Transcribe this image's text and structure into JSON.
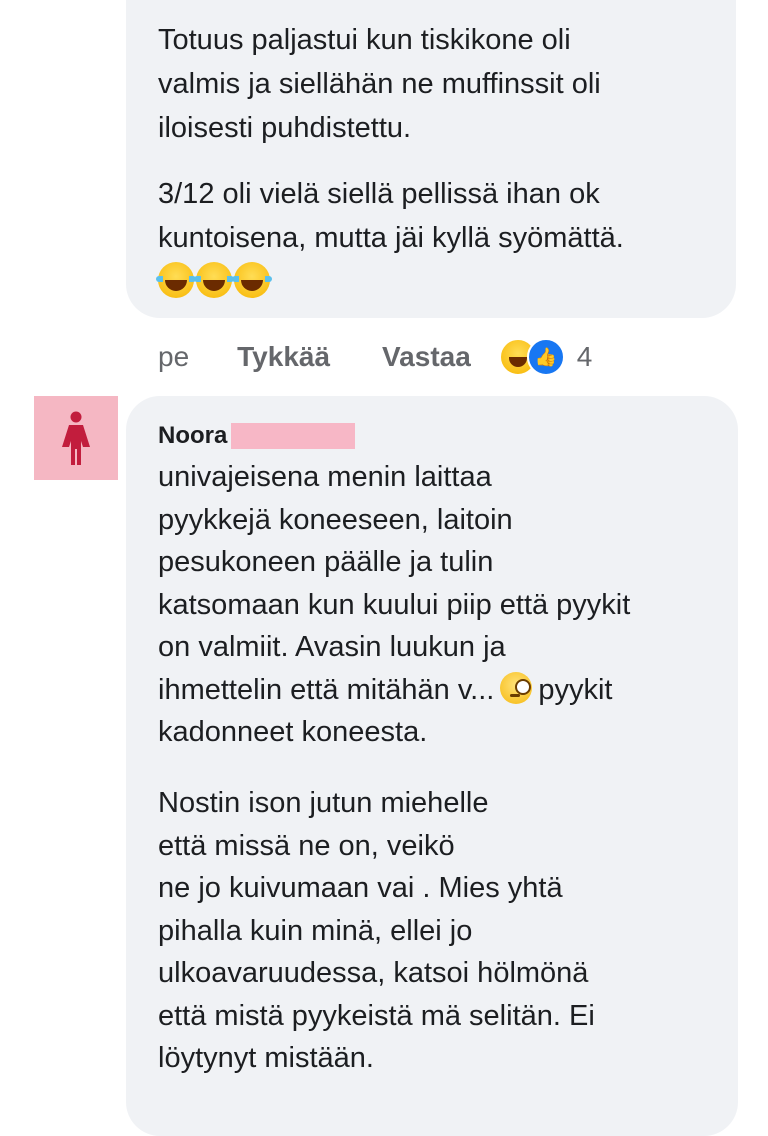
{
  "comment_top": {
    "paragraph_1": "Totuus paljastui kun tiskikone oli\nvalmis ja siellähän ne muffinssit oli\niloisesti puhdistettu.",
    "paragraph_2": "3/12 oli vielä siellä pellissä ihan ok\nkuntoisena, mutta jäi kyllä syömättä.",
    "emoji_row": [
      "laugh-cry-emoji",
      "laugh-cry-emoji",
      "laugh-cry-emoji"
    ]
  },
  "actions": {
    "time": "pe",
    "like": "Tykkää",
    "reply": "Vastaa",
    "reaction_icons": [
      "haha-reaction-icon",
      "like-reaction-icon"
    ],
    "reaction_count": "4"
  },
  "comment_bottom": {
    "author": "Noora",
    "avatar_icon": "female-person-icon",
    "lines_1": {
      "l1": "univajeisena menin laittaa",
      "l2": "pyykkejä koneeseen, laitoin",
      "l3": "pesukoneen päälle ja tulin",
      "l4": "katsomaan kun kuului piip että pyykit",
      "l5": "on valmiit. Avasin luukun ja",
      "l6a": "ihmettelin että mitähän v...",
      "l6b": "pyykit",
      "l7": "kadonneet koneesta."
    },
    "lines_2": {
      "l1": "Nostin ison jutun miehelle",
      "l2": "että missä ne on, veikö",
      "l3": "ne jo kuivumaan vai . Mies yhtä",
      "l4": "pihalla kuin minä, ellei jo",
      "l5": "ulkoavaruudessa, katsoi hölmönä",
      "l6": "että mistä pyykeistä mä selitän. Ei",
      "l7": "löytynyt mistään."
    }
  },
  "colors": {
    "bubble": "#f0f2f5",
    "text": "#1c1e21",
    "muted": "#65676b",
    "avatar_bg": "#f5b7c3",
    "avatar_fg": "#c21d3d",
    "like_blue": "#1877f2"
  }
}
